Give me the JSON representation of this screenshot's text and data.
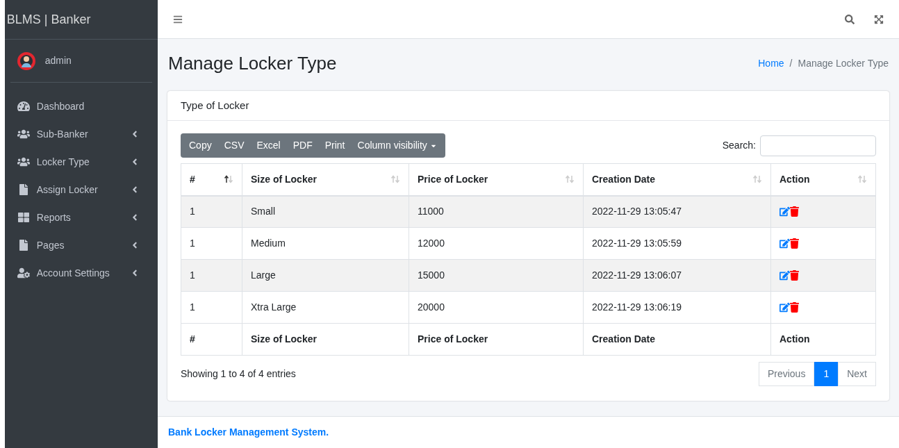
{
  "sidebar": {
    "brand": "BLMS | Banker",
    "user": "admin",
    "items": [
      {
        "label": "Dashboard",
        "expandable": false
      },
      {
        "label": "Sub-Banker",
        "expandable": true
      },
      {
        "label": "Locker Type",
        "expandable": true
      },
      {
        "label": "Assign Locker",
        "expandable": true
      },
      {
        "label": "Reports",
        "expandable": true
      },
      {
        "label": "Pages",
        "expandable": true
      },
      {
        "label": "Account Settings",
        "expandable": true
      }
    ]
  },
  "page": {
    "title": "Manage Locker Type",
    "breadcrumb_separator": "/",
    "breadcrumb": [
      {
        "label": "Home",
        "link": true
      },
      {
        "label": "Manage Locker Type",
        "link": false
      }
    ]
  },
  "card": {
    "title": "Type of Locker",
    "buttons": [
      {
        "label": "Copy",
        "dropdown": false
      },
      {
        "label": "CSV",
        "dropdown": false
      },
      {
        "label": "Excel",
        "dropdown": false
      },
      {
        "label": "PDF",
        "dropdown": false
      },
      {
        "label": "Print",
        "dropdown": false
      },
      {
        "label": "Column visibility",
        "dropdown": true
      }
    ],
    "search_label": "Search:",
    "table": {
      "columns": [
        {
          "label": "#",
          "sorted_ascending": true
        },
        {
          "label": "Size of Locker",
          "sorted_ascending": false
        },
        {
          "label": "Price of Locker",
          "sorted_ascending": false
        },
        {
          "label": "Creation Date",
          "sorted_ascending": false
        },
        {
          "label": "Action",
          "sorted_ascending": false
        }
      ],
      "rows": [
        [
          "1",
          "Small",
          "11000",
          "2022-11-29 13:05:47"
        ],
        [
          "1",
          "Medium",
          "12000",
          "2022-11-29 13:05:59"
        ],
        [
          "1",
          "Large",
          "15000",
          "2022-11-29 13:06:07"
        ],
        [
          "1",
          "Xtra Large",
          "20000",
          "2022-11-29 13:06:19"
        ]
      ],
      "footer": [
        "#",
        "Size of Locker",
        "Price of Locker",
        "Creation Date",
        "Action"
      ]
    },
    "info": "Showing 1 to 4 of 4 entries",
    "pagination": [
      {
        "label": "Previous",
        "selected": false,
        "disabled": true
      },
      {
        "label": "1",
        "selected": true,
        "disabled": false
      },
      {
        "label": "Next",
        "selected": false,
        "disabled": true
      }
    ]
  },
  "footer": "Bank Locker Management System."
}
